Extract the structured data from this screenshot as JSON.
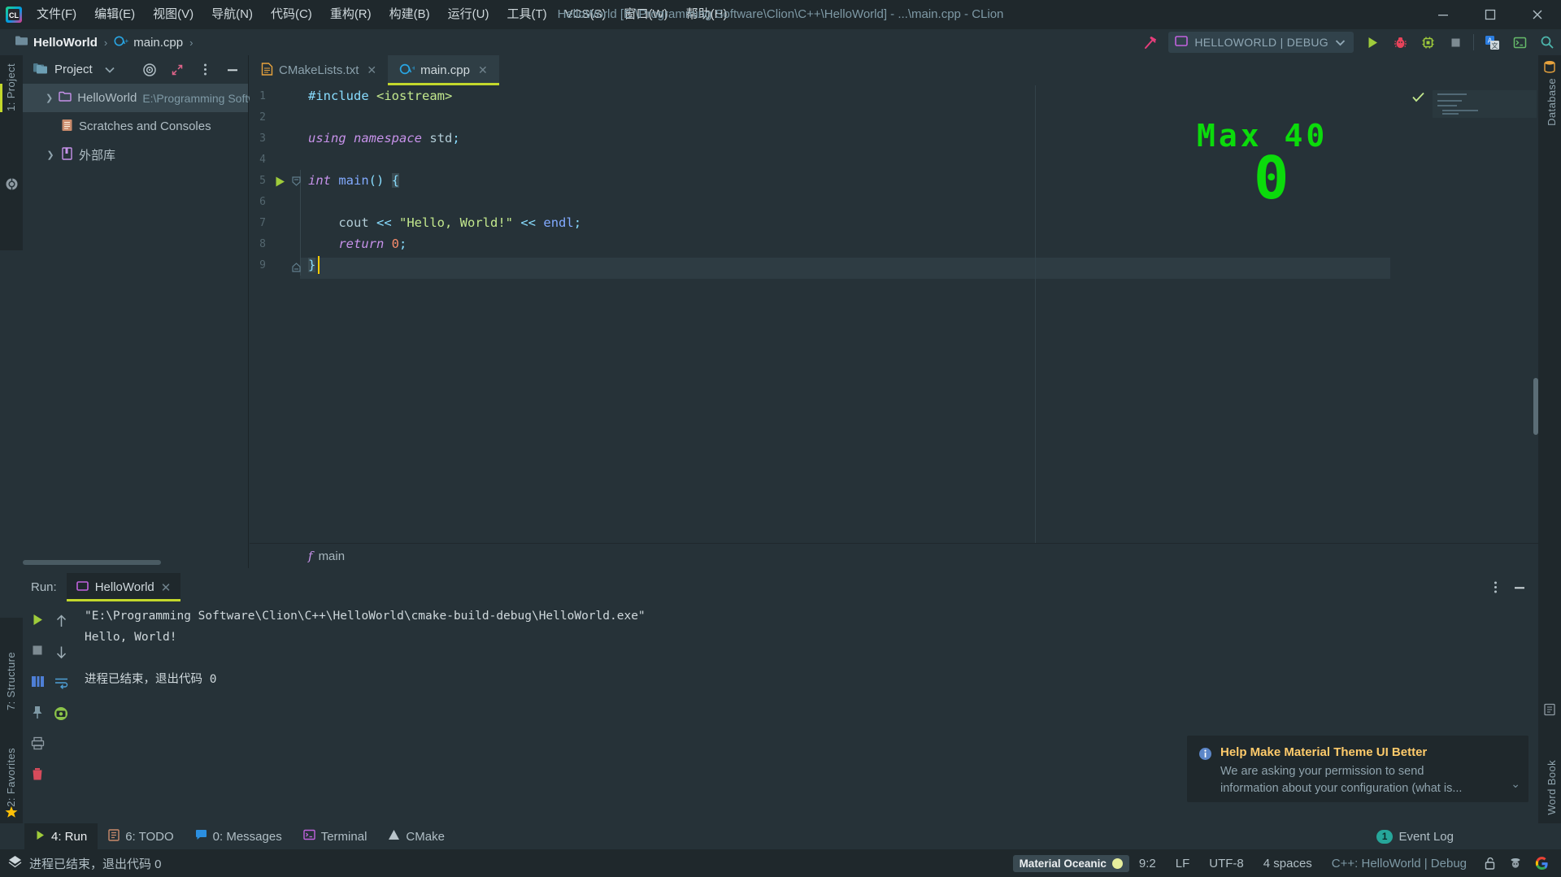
{
  "window": {
    "title": "HelloWorld [E:\\Programming Software\\Clion\\C++\\HelloWorld] - ...\\main.cpp - CLion",
    "logo": "clion-logo-icon",
    "controls": {
      "minimize": "—",
      "maximize": "❐",
      "close": "✕"
    }
  },
  "menu": [
    {
      "label": "文件(F)",
      "name": "menu-file"
    },
    {
      "label": "编辑(E)",
      "name": "menu-edit"
    },
    {
      "label": "视图(V)",
      "name": "menu-view"
    },
    {
      "label": "导航(N)",
      "name": "menu-navigate"
    },
    {
      "label": "代码(C)",
      "name": "menu-code"
    },
    {
      "label": "重构(R)",
      "name": "menu-refactor"
    },
    {
      "label": "构建(B)",
      "name": "menu-build"
    },
    {
      "label": "运行(U)",
      "name": "menu-run"
    },
    {
      "label": "工具(T)",
      "name": "menu-tools"
    },
    {
      "label": "VCS(S)",
      "name": "menu-vcs"
    },
    {
      "label": "窗口(W)",
      "name": "menu-window"
    },
    {
      "label": "帮助(H)",
      "name": "menu-help"
    }
  ],
  "breadcrumb": {
    "project": "HelloWorld",
    "file": "main.cpp",
    "separator": "›"
  },
  "toolbar": {
    "build_icon": "hammer-icon",
    "run_config": "HELLOWORLD | DEBUG",
    "run_config_icon": "run-config-icon",
    "dropdown_icon": "chevron-down-icon",
    "run_icon": "run-icon",
    "debug_icon": "debug-bug-icon",
    "profile_icon": "profiler-icon",
    "stop_icon": "stop-icon",
    "translate_icon": "translate-icon",
    "terminal_icon": "terminal-icon",
    "search_icon": "search-icon"
  },
  "left_stripe": {
    "project_label": "1: Project",
    "structure_label": "7: Structure",
    "favorites_label": "2: Favorites",
    "vcs_icon": "version-control-icon",
    "star_icon": "star-icon"
  },
  "right_stripe": {
    "database_label": "Database",
    "word_book_label": "Word Book"
  },
  "project_panel": {
    "title": "Project",
    "title_icon": "project-folder-icon",
    "chevron_icon": "chevron-down-icon",
    "locate_icon": "target-locate-icon",
    "collapse_icon": "collapse-all-icon",
    "options_icon": "more-options-icon",
    "hide_icon": "hide-panel-icon",
    "tree": [
      {
        "label": "HelloWorld",
        "path": "E:\\Programming Softw",
        "icon": "folder-icon",
        "expandable": true,
        "selected": true
      },
      {
        "label": "Scratches and Consoles",
        "path": "",
        "icon": "scratches-icon",
        "expandable": false,
        "selected": false
      },
      {
        "label": "外部库",
        "path": "",
        "icon": "external-libraries-icon",
        "expandable": true,
        "selected": false
      }
    ]
  },
  "editor": {
    "tabs": [
      {
        "label": "CMakeLists.txt",
        "icon": "cmake-file-icon",
        "active": false,
        "close": "✕"
      },
      {
        "label": "main.cpp",
        "icon": "cpp-file-icon",
        "active": true,
        "close": "✕"
      }
    ],
    "line_numbers": [
      "1",
      "2",
      "3",
      "4",
      "5",
      "6",
      "7",
      "8",
      "9"
    ],
    "code": [
      "#include <iostream>",
      "",
      "using namespace std;",
      "",
      "int main() {",
      "",
      "    cout << \"Hello, World!\" << endl;",
      "    return 0;",
      "}"
    ],
    "breadcrumb_function": "main",
    "breadcrumb_function_icon": "function-icon",
    "gutter_run_icon": "gutter-run-icon",
    "inspection_ok_icon": "inspection-ok-check"
  },
  "overlay_widget": {
    "label": "Max 40",
    "value": "0",
    "color": "#0BDB0B"
  },
  "run_panel": {
    "label": "Run:",
    "tab": "HelloWorld",
    "tab_icon": "run-config-icon",
    "tab_close": "✕",
    "options_icon": "more-options-icon",
    "hide_icon": "hide-panel-icon",
    "toolbar_icons": [
      "rerun-icon",
      "stop-icon",
      "layout-icon",
      "pin-icon",
      "print-icon",
      "trash-icon",
      "scroll-up-icon",
      "scroll-down-icon",
      "soft-wrap-icon",
      "camera-icon"
    ],
    "console": [
      "\"E:\\Programming Software\\Clion\\C++\\HelloWorld\\cmake-build-debug\\HelloWorld.exe\"",
      "Hello, World!",
      "",
      "进程已结束，退出代码 0"
    ]
  },
  "notification": {
    "icon": "info-icon",
    "title": "Help Make Material Theme UI Better",
    "body_line1": "We are asking your permission to send",
    "body_line2": "information about your configuration (what is...",
    "expand_icon": "chevron-down-icon"
  },
  "bottom_strip": [
    {
      "label": "4: Run",
      "icon": "run-icon",
      "active": true,
      "name": "bottom-tab-run"
    },
    {
      "label": "6: TODO",
      "icon": "todo-icon",
      "active": false,
      "name": "bottom-tab-todo"
    },
    {
      "label": "0: Messages",
      "icon": "messages-icon",
      "active": false,
      "name": "bottom-tab-messages"
    },
    {
      "label": "Terminal",
      "icon": "terminal-icon",
      "active": false,
      "name": "bottom-tab-terminal"
    },
    {
      "label": "CMake",
      "icon": "cmake-icon",
      "active": false,
      "name": "bottom-tab-cmake"
    }
  ],
  "event_log": {
    "count": "1",
    "label": "Event Log"
  },
  "statusbar": {
    "message": "进程已结束，退出代码 0",
    "message_icon": "status-diamond-icon",
    "theme": "Material Oceanic",
    "theme_dot_color": "#E6EE9C",
    "caret_position": "9:2",
    "line_separator": "LF",
    "encoding": "UTF-8",
    "indent": "4 spaces",
    "config": "C++: HelloWorld | Debug",
    "lock_icon": "unlocked-icon",
    "inspector_icon": "inspector-icon",
    "google_icon": "google-icon"
  }
}
